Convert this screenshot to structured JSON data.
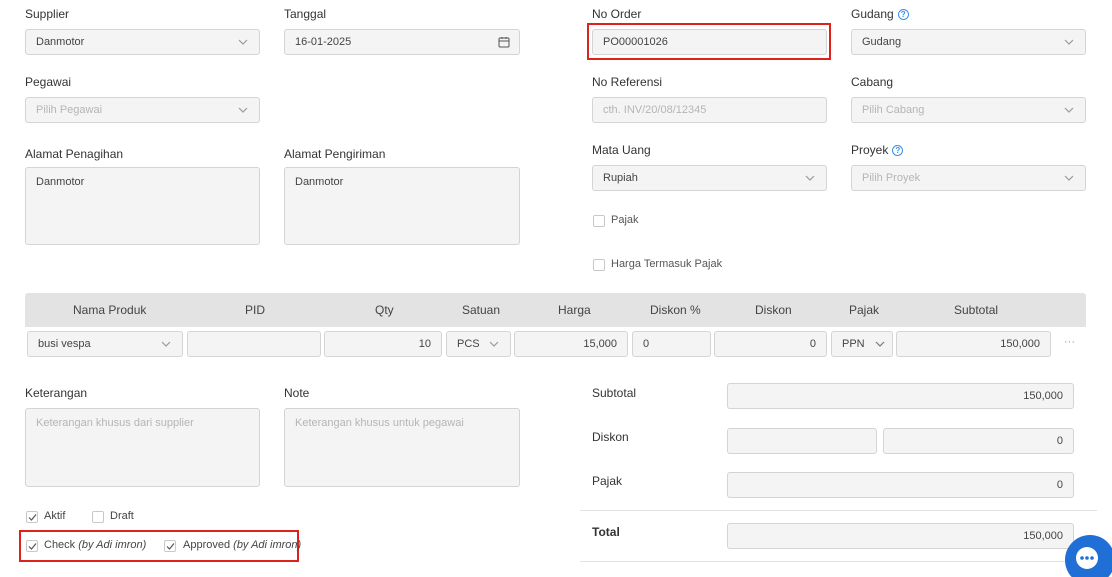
{
  "form": {
    "supplier": {
      "label": "Supplier",
      "value": "Danmotor"
    },
    "tanggal": {
      "label": "Tanggal",
      "value": "16-01-2025"
    },
    "no_order": {
      "label": "No Order",
      "value": "PO00001026"
    },
    "gudang": {
      "label": "Gudang",
      "value": "Gudang",
      "help": "?"
    },
    "pegawai": {
      "label": "Pegawai",
      "placeholder": "Pilih Pegawai"
    },
    "no_referensi": {
      "label": "No Referensi",
      "placeholder": "cth. INV/20/08/12345"
    },
    "cabang": {
      "label": "Cabang",
      "placeholder": "Pilih Cabang"
    },
    "alamat_penagihan": {
      "label": "Alamat Penagihan",
      "value": "Danmotor"
    },
    "alamat_pengiriman": {
      "label": "Alamat Pengiriman",
      "value": "Danmotor"
    },
    "mata_uang": {
      "label": "Mata Uang",
      "value": "Rupiah"
    },
    "proyek": {
      "label": "Proyek",
      "placeholder": "Pilih Proyek",
      "help": "?"
    },
    "pajak_checkbox": {
      "label": "Pajak",
      "checked": false
    },
    "harga_termasuk_pajak": {
      "label": "Harga Termasuk Pajak",
      "checked": false
    }
  },
  "table": {
    "headers": [
      "Nama Produk",
      "PID",
      "Qty",
      "Satuan",
      "Harga",
      "Diskon %",
      "Diskon",
      "Pajak",
      "Subtotal"
    ],
    "rows": [
      {
        "nama_produk": "busi vespa",
        "pid": "",
        "qty": "10",
        "satuan": "PCS",
        "harga": "15,000",
        "diskon_pct": "0",
        "diskon": "0",
        "pajak": "PPN",
        "subtotal": "150,000",
        "more": "···"
      }
    ]
  },
  "notes": {
    "keterangan": {
      "label": "Keterangan",
      "placeholder": "Keterangan khusus dari supplier"
    },
    "note": {
      "label": "Note",
      "placeholder": "Keterangan khusus untuk pegawai"
    }
  },
  "status": {
    "aktif": {
      "label": "Aktif",
      "checked": true
    },
    "draft": {
      "label": "Draft",
      "checked": false
    },
    "check": {
      "label": "Check",
      "by": "(by Adi imron)",
      "checked": true
    },
    "approved": {
      "label": "Approved",
      "by": "(by Adi imron)",
      "checked": true
    }
  },
  "summary": {
    "subtotal": {
      "label": "Subtotal",
      "value": "150,000"
    },
    "diskon": {
      "label": "Diskon",
      "value": "0"
    },
    "pajak": {
      "label": "Pajak",
      "value": "0"
    },
    "total": {
      "label": "Total",
      "value": "150,000"
    }
  },
  "colors": {
    "highlight": "#e0201a",
    "accent": "#3a8ee6",
    "chat": "#1f6fd6"
  }
}
